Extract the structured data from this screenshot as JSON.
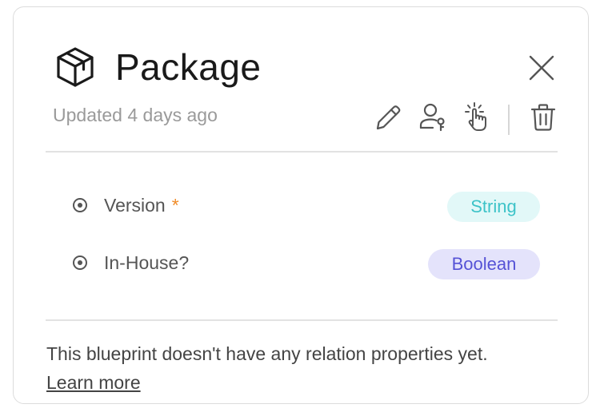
{
  "header": {
    "title": "Package",
    "icon": "package-box-icon",
    "updated_text": "Updated 4 days ago"
  },
  "actions": [
    {
      "name": "edit",
      "icon": "pencil-icon"
    },
    {
      "name": "permissions",
      "icon": "user-key-icon"
    },
    {
      "name": "actions",
      "icon": "pointer-click-icon"
    },
    {
      "name": "delete",
      "icon": "trash-icon"
    }
  ],
  "close_icon": "close-icon",
  "properties": [
    {
      "label": "Version",
      "required_mark": "*",
      "type_label": "String"
    },
    {
      "label": "In-House?",
      "required_mark": "",
      "type_label": "Boolean"
    }
  ],
  "relations": {
    "empty_text": "This blueprint doesn't have any relation properties yet.",
    "learn_more": "Learn more"
  },
  "colors": {
    "string_badge_bg": "#e2f8f8",
    "string_badge_text": "#3dc3c8",
    "boolean_badge_bg": "#e4e3fb",
    "boolean_badge_text": "#5552d6",
    "required_mark": "#f08c2a"
  }
}
